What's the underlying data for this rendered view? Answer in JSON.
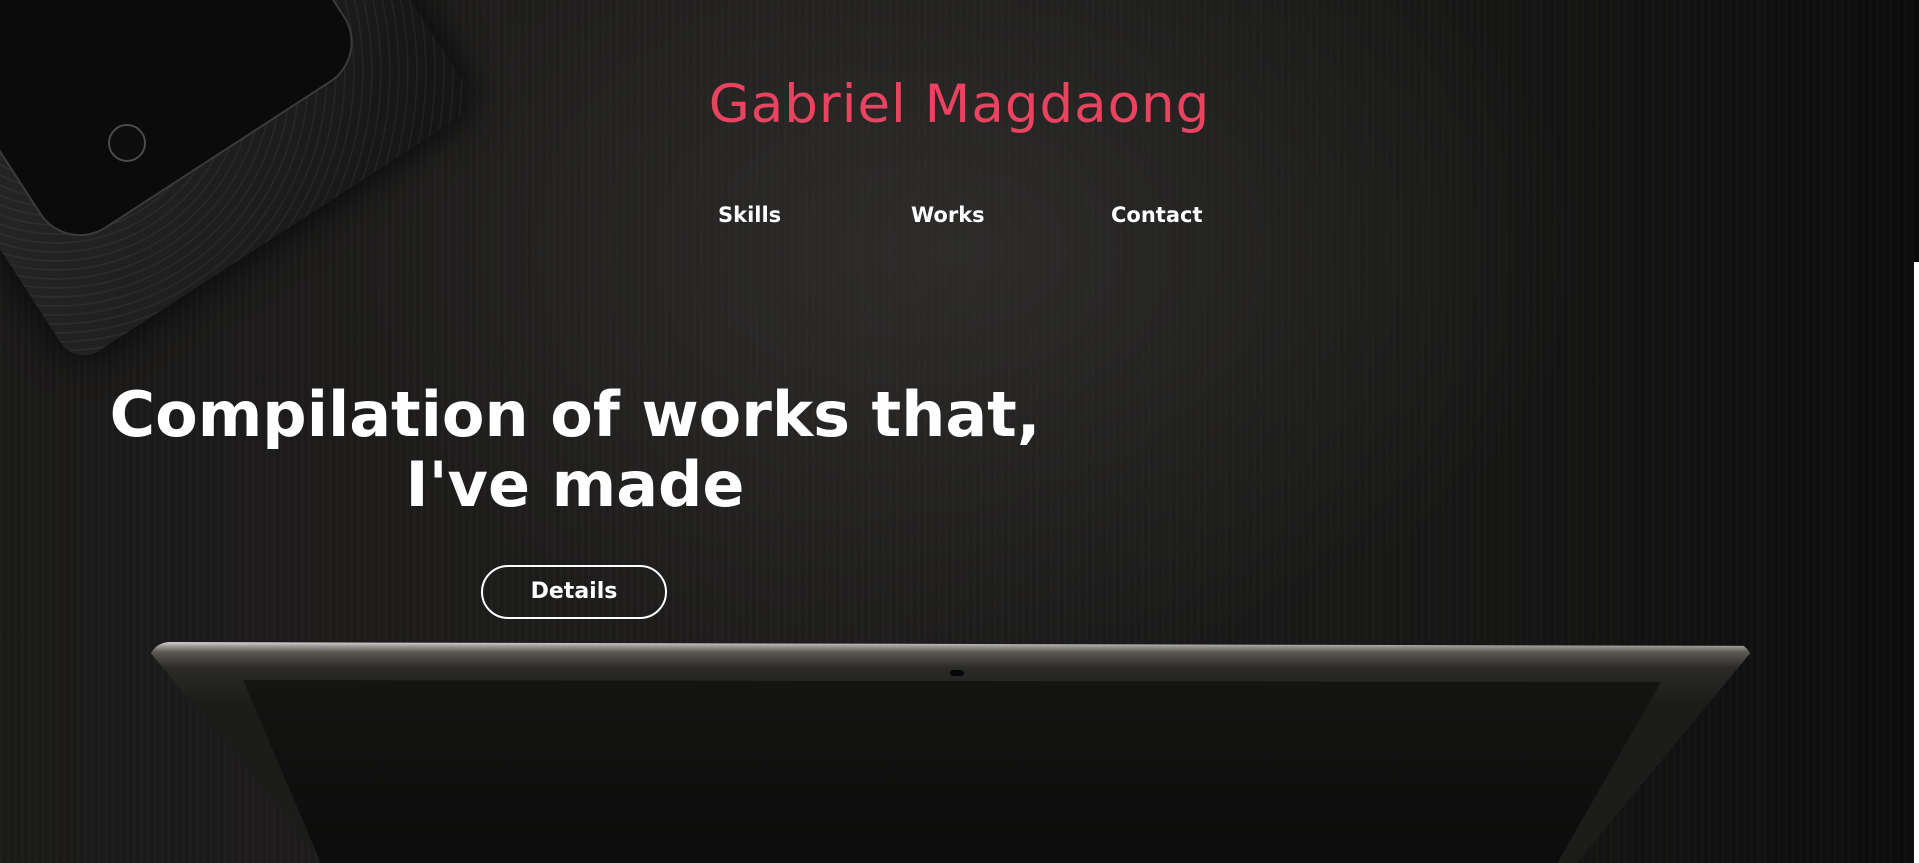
{
  "header": {
    "brand": "Gabriel Magdaong"
  },
  "nav": {
    "items": [
      {
        "label": "Skills"
      },
      {
        "label": "Works"
      },
      {
        "label": "Contact"
      }
    ]
  },
  "hero": {
    "title_line1": "Compilation of works that,",
    "title_line2": "I've made",
    "button_label": "Details"
  },
  "colors": {
    "brand": "#ea4360",
    "text": "#ffffff",
    "background": "#1b1a19"
  },
  "icons": [
    "phone-decoration",
    "laptop-decoration"
  ]
}
